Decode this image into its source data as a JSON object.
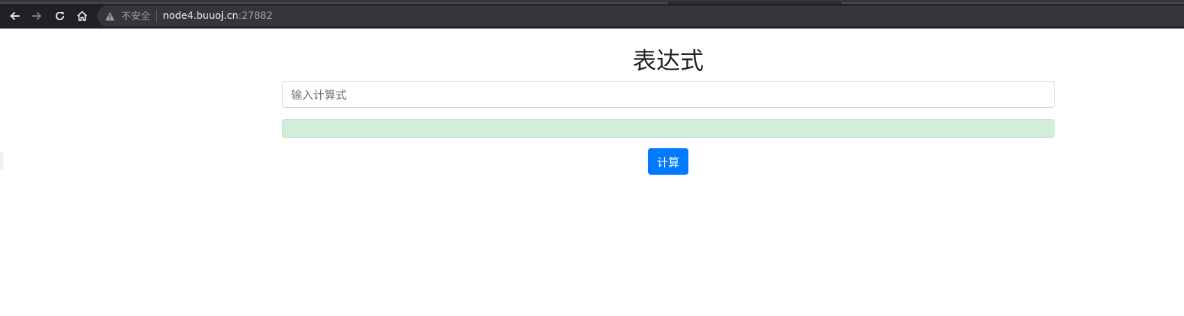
{
  "browser": {
    "security_label": "不安全",
    "url_host": "node4.buuoj.cn",
    "url_port": ":27882"
  },
  "page": {
    "title": "表达式",
    "input": {
      "placeholder": "输入计算式",
      "value": ""
    },
    "result_text": "",
    "calculate_label": "计算"
  },
  "colors": {
    "chrome_bg": "#202124",
    "omnibox_bg": "#35363a",
    "alert_bg": "#d4edda",
    "button_primary": "#007bff"
  }
}
